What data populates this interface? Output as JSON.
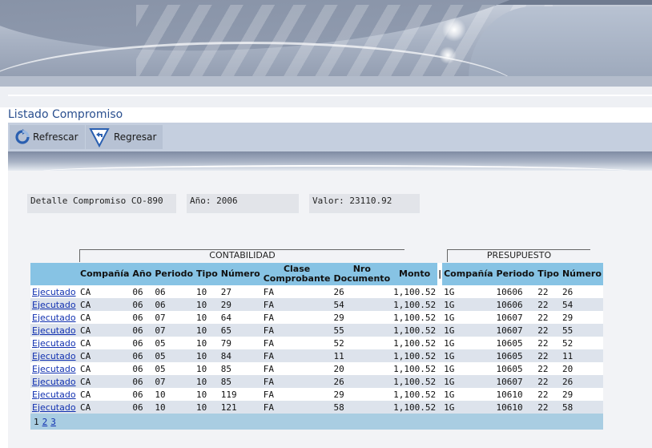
{
  "page_title": "Listado Compromiso",
  "toolbar": {
    "refresh_label": "Refrescar",
    "back_label": "Regresar"
  },
  "detail": {
    "compromiso": "Detalle Compromiso CO-890",
    "anio": "Año: 2006",
    "valor": "Valor: 23110.92"
  },
  "groups": {
    "contabilidad": "CONTABILIDAD",
    "presupuesto": "PRESUPUESTO"
  },
  "columns": {
    "compania": "Compañía",
    "anio": "Año",
    "periodo": "Periodo",
    "tipo": "Tipo",
    "numero": "Número",
    "clase_1": "Clase",
    "clase_2": "Comprobante",
    "nro_1": "Nro",
    "nro_2": "Documento",
    "monto": "Monto",
    "p_compania": "Compañía",
    "p_periodo": "Periodo",
    "p_tipo": "Tipo",
    "p_numero": "Número"
  },
  "separator": "|",
  "rows": [
    {
      "estado": "Ejecutado",
      "compania": "CA",
      "anio": "06",
      "periodo": "06",
      "tipo": "10",
      "numero": "27",
      "clase": "FA",
      "nro": "26",
      "monto": "1,100.52",
      "p_compania": "1G",
      "p_periodo": "10606",
      "p_tipo": "22",
      "p_numero": "26"
    },
    {
      "estado": "Ejecutado",
      "compania": "CA",
      "anio": "06",
      "periodo": "06",
      "tipo": "10",
      "numero": "29",
      "clase": "FA",
      "nro": "54",
      "monto": "1,100.52",
      "p_compania": "1G",
      "p_periodo": "10606",
      "p_tipo": "22",
      "p_numero": "54"
    },
    {
      "estado": "Ejecutado",
      "compania": "CA",
      "anio": "06",
      "periodo": "07",
      "tipo": "10",
      "numero": "64",
      "clase": "FA",
      "nro": "29",
      "monto": "1,100.52",
      "p_compania": "1G",
      "p_periodo": "10607",
      "p_tipo": "22",
      "p_numero": "29"
    },
    {
      "estado": "Ejecutado",
      "compania": "CA",
      "anio": "06",
      "periodo": "07",
      "tipo": "10",
      "numero": "65",
      "clase": "FA",
      "nro": "55",
      "monto": "1,100.52",
      "p_compania": "1G",
      "p_periodo": "10607",
      "p_tipo": "22",
      "p_numero": "55"
    },
    {
      "estado": "Ejecutado",
      "compania": "CA",
      "anio": "06",
      "periodo": "05",
      "tipo": "10",
      "numero": "79",
      "clase": "FA",
      "nro": "52",
      "monto": "1,100.52",
      "p_compania": "1G",
      "p_periodo": "10605",
      "p_tipo": "22",
      "p_numero": "52"
    },
    {
      "estado": "Ejecutado",
      "compania": "CA",
      "anio": "06",
      "periodo": "05",
      "tipo": "10",
      "numero": "84",
      "clase": "FA",
      "nro": "11",
      "monto": "1,100.52",
      "p_compania": "1G",
      "p_periodo": "10605",
      "p_tipo": "22",
      "p_numero": "11"
    },
    {
      "estado": "Ejecutado",
      "compania": "CA",
      "anio": "06",
      "periodo": "05",
      "tipo": "10",
      "numero": "85",
      "clase": "FA",
      "nro": "20",
      "monto": "1,100.52",
      "p_compania": "1G",
      "p_periodo": "10605",
      "p_tipo": "22",
      "p_numero": "20"
    },
    {
      "estado": "Ejecutado",
      "compania": "CA",
      "anio": "06",
      "periodo": "07",
      "tipo": "10",
      "numero": "85",
      "clase": "FA",
      "nro": "26",
      "monto": "1,100.52",
      "p_compania": "1G",
      "p_periodo": "10607",
      "p_tipo": "22",
      "p_numero": "26"
    },
    {
      "estado": "Ejecutado",
      "compania": "CA",
      "anio": "06",
      "periodo": "10",
      "tipo": "10",
      "numero": "119",
      "clase": "FA",
      "nro": "29",
      "monto": "1,100.52",
      "p_compania": "1G",
      "p_periodo": "10610",
      "p_tipo": "22",
      "p_numero": "29"
    },
    {
      "estado": "Ejecutado",
      "compania": "CA",
      "anio": "06",
      "periodo": "10",
      "tipo": "10",
      "numero": "121",
      "clase": "FA",
      "nro": "58",
      "monto": "1,100.52",
      "p_compania": "1G",
      "p_periodo": "10610",
      "p_tipo": "22",
      "p_numero": "58"
    }
  ],
  "pages": [
    "1",
    "2",
    "3"
  ],
  "current_page": "1",
  "icons": {
    "refresh": "refresh-icon",
    "back": "back-arrow-icon"
  },
  "colors": {
    "header_bg": "#87c3e4",
    "title": "#2a4f8f",
    "link": "#1030b0"
  }
}
